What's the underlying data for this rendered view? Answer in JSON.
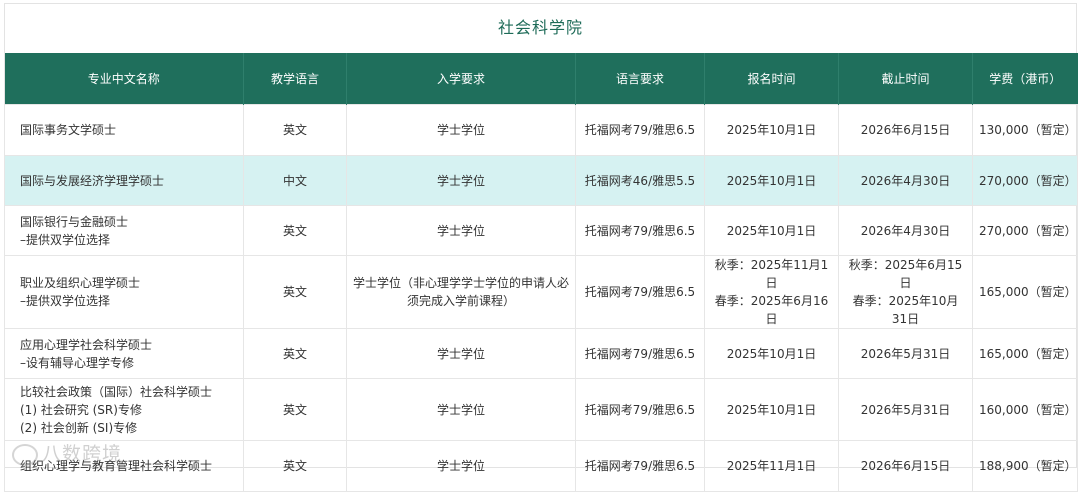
{
  "page": {
    "title": "社会科学院"
  },
  "table": {
    "headers": [
      "专业中文名称",
      "教学语言",
      "入学要求",
      "语言要求",
      "报名时间",
      "截止时间",
      "学费（港币）"
    ],
    "rows": [
      {
        "name_lines": [
          "国际事务文学硕士"
        ],
        "language": "英文",
        "admission_lines": [
          "学士学位"
        ],
        "lang_req": "托福网考79/雅思6.5",
        "apply_lines": [
          "2025年10月1日"
        ],
        "deadline_lines": [
          "2026年6月15日"
        ],
        "fee": "130,000（暂定）",
        "highlight": false
      },
      {
        "name_lines": [
          "国际与发展经济学理学硕士"
        ],
        "language": "中文",
        "admission_lines": [
          "学士学位"
        ],
        "lang_req": "托福网考46/雅思5.5",
        "apply_lines": [
          "2025年10月1日"
        ],
        "deadline_lines": [
          "2026年4月30日"
        ],
        "fee": "270,000（暂定）",
        "highlight": true
      },
      {
        "name_lines": [
          "国际银行与金融硕士",
          "–提供双学位选择"
        ],
        "language": "英文",
        "admission_lines": [
          "学士学位"
        ],
        "lang_req": "托福网考79/雅思6.5",
        "apply_lines": [
          "2025年10月1日"
        ],
        "deadline_lines": [
          "2026年4月30日"
        ],
        "fee": "270,000（暂定）",
        "highlight": false
      },
      {
        "name_lines": [
          "职业及组织心理学硕士",
          "–提供双学位选择"
        ],
        "language": "英文",
        "admission_lines": [
          "学士学位（非心理学学士学位的申请人必",
          "须完成入学前课程）"
        ],
        "lang_req": "托福网考79/雅思6.5",
        "apply_lines": [
          "秋季：2025年11月1日",
          "春季：2025年6月16日"
        ],
        "deadline_lines": [
          "秋季：2025年6月15日",
          "春季：2025年10月31日"
        ],
        "fee": "165,000（暂定）",
        "highlight": false
      },
      {
        "name_lines": [
          "应用心理学社会科学硕士",
          "–设有辅导心理学专修"
        ],
        "language": "英文",
        "admission_lines": [
          "学士学位"
        ],
        "lang_req": "托福网考79/雅思6.5",
        "apply_lines": [
          "2025年10月1日"
        ],
        "deadline_lines": [
          "2026年5月31日"
        ],
        "fee": "165,000（暂定）",
        "highlight": false
      },
      {
        "name_lines": [
          "比较社会政策（国际）社会科学硕士",
          "(1) 社会研究 (SR)专修",
          "(2) 社会创新 (SI)专修"
        ],
        "language": "英文",
        "admission_lines": [
          "学士学位"
        ],
        "lang_req": "托福网考79/雅思6.5",
        "apply_lines": [
          "2025年10月1日"
        ],
        "deadline_lines": [
          "2026年5月31日"
        ],
        "fee": "160,000（暂定）",
        "highlight": false
      },
      {
        "name_lines": [
          "组织心理学与教育管理社会科学硕士"
        ],
        "language": "英文",
        "admission_lines": [
          "学士学位"
        ],
        "lang_req": "托福网考79/雅思6.5",
        "apply_lines": [
          "2025年11月1日"
        ],
        "deadline_lines": [
          "2026年6月15日"
        ],
        "fee": "188,900（暂定）",
        "highlight": false
      }
    ]
  },
  "watermark": {
    "text": "八数跨境"
  }
}
